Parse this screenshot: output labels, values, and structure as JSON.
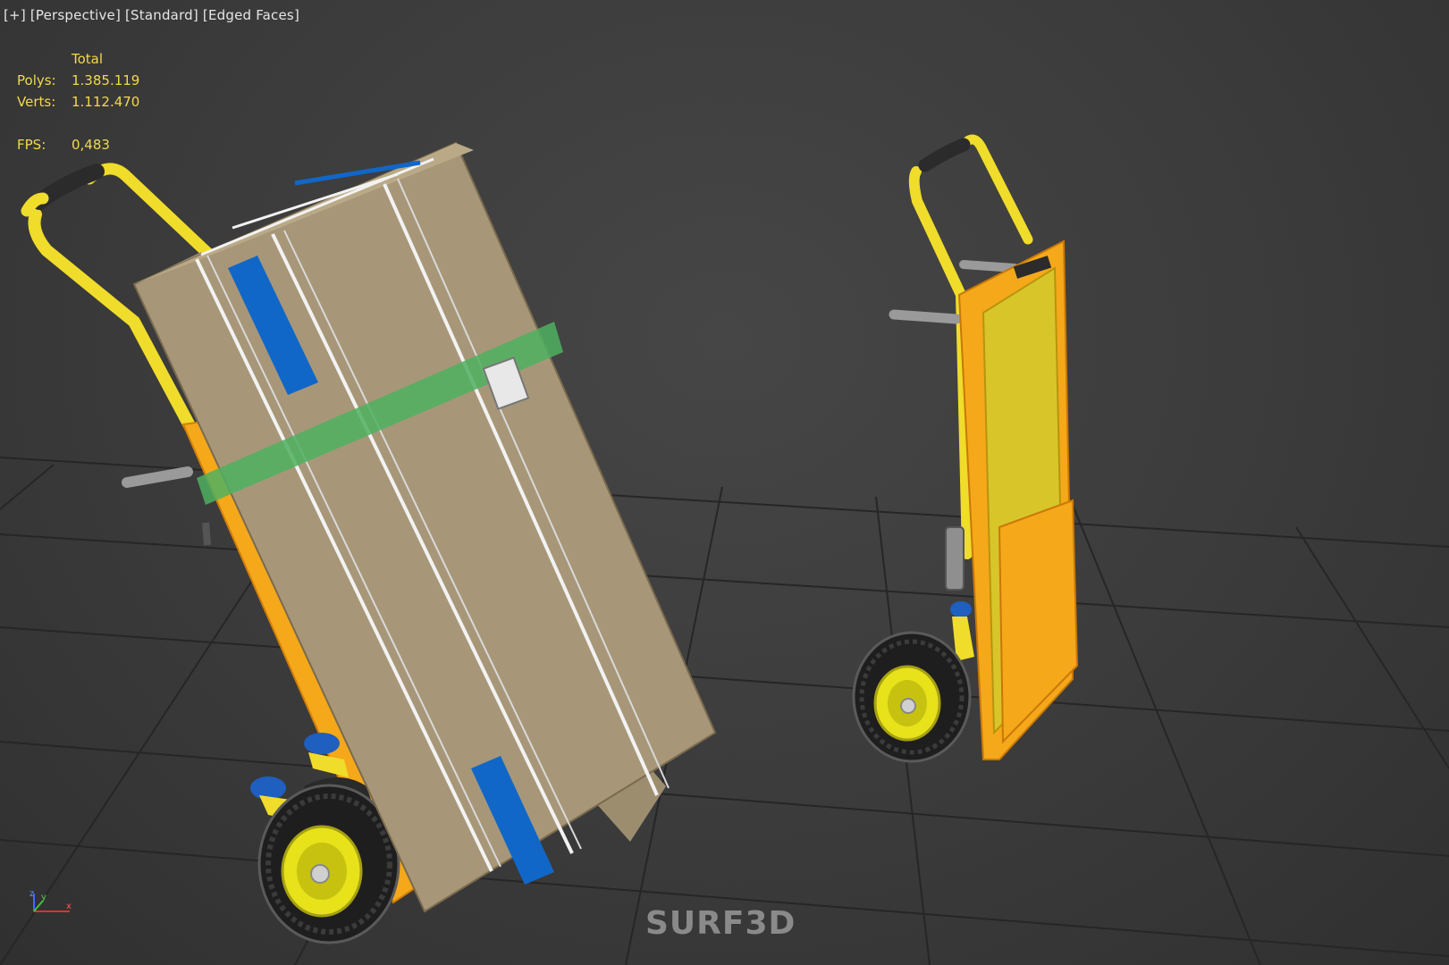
{
  "viewport": {
    "menu_plus": "[+]",
    "menu_view": "[Perspective]",
    "menu_shading": "[Standard]",
    "menu_display": "[Edged Faces]"
  },
  "stats": {
    "header": "Total",
    "polys_label": "Polys:",
    "polys_value": "1.385.119",
    "verts_label": "Verts:",
    "verts_value": "1.112.470",
    "fps_label": "FPS:",
    "fps_value": "0,483"
  },
  "axis": {
    "z": "z",
    "y": "y",
    "x": "x"
  },
  "watermark": "SURF3D",
  "colors": {
    "background": "#3a3a3a",
    "grid": "#2a2a2a",
    "stats_text": "#f2d94b",
    "frame_yellow": "#f0dc2a",
    "frame_orange": "#f5a81a",
    "box": "#a79778",
    "tape_blue": "#1167c8",
    "strap_green": "#4fb060"
  }
}
